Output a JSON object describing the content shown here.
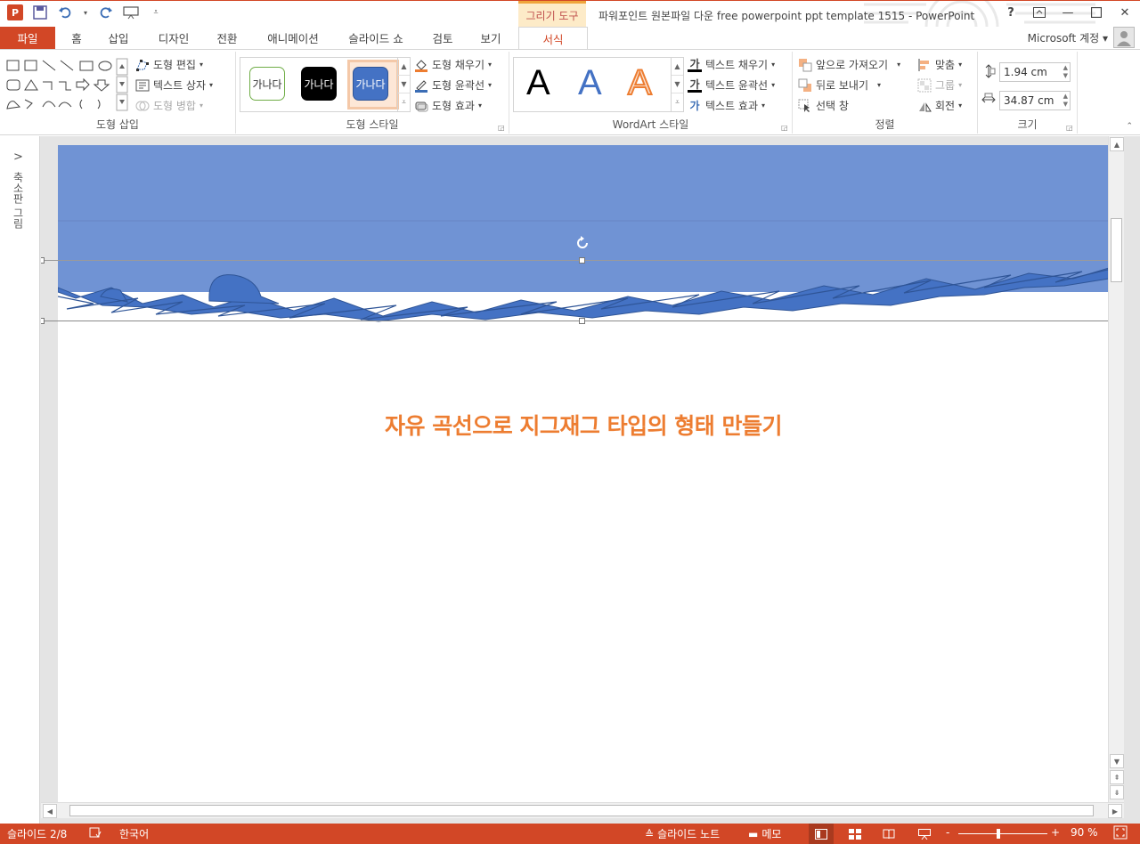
{
  "titlebar": {
    "logo": "P",
    "context_tab": "그리기 도구",
    "title": "파워포인트 원본파일 다운 free powerpoint ppt template 1515 - PowerPoint",
    "help": "?",
    "controls": [
      "restore-ribbon",
      "minimize",
      "maximize",
      "close"
    ]
  },
  "tabs": {
    "file": "파일",
    "items": [
      "홈",
      "삽입",
      "디자인",
      "전환",
      "애니메이션",
      "슬라이드 쇼",
      "검토",
      "보기"
    ],
    "format": "서식",
    "account": "Microsoft 계정"
  },
  "ribbon": {
    "insert_shapes": {
      "label": "도형 삽입",
      "edit_shape": "도형 편집",
      "text_box": "텍스트 상자",
      "merge_shapes": "도형 병합"
    },
    "shape_styles": {
      "label": "도형 스타일",
      "swatch_text": "가나다",
      "fill": "도형 채우기",
      "outline": "도형 윤곽선",
      "effects": "도형 효과"
    },
    "wordart": {
      "label": "WordArt 스타일",
      "letter": "A",
      "text_fill": "텍스트 채우기",
      "text_outline": "텍스트 윤곽선",
      "text_effects": "텍스트 효과"
    },
    "arrange": {
      "label": "정렬",
      "bring_forward": "앞으로 가져오기",
      "send_backward": "뒤로 보내기",
      "selection_pane": "선택 창",
      "align": "맞춤",
      "group": "그룹",
      "rotate": "회전"
    },
    "size": {
      "label": "크기",
      "height": "1.94 cm",
      "width": "34.87 cm"
    }
  },
  "thumb_pane": {
    "toggle": ">",
    "label": "축소판 그림"
  },
  "slide": {
    "title": "자유 곡선으로 지그재그 타입의 형태 만들기",
    "band_color": "#7093d4",
    "shape_color": "#4472c4"
  },
  "statusbar": {
    "slide_counter": "슬라이드 2/8",
    "language": "한국어",
    "notes": "슬라이드 노트",
    "comments": "메모",
    "zoom": "90 %",
    "zoom_minus": "-",
    "zoom_plus": "+"
  },
  "colors": {
    "accent": "#d24726",
    "title_orange": "#ed7d31"
  }
}
